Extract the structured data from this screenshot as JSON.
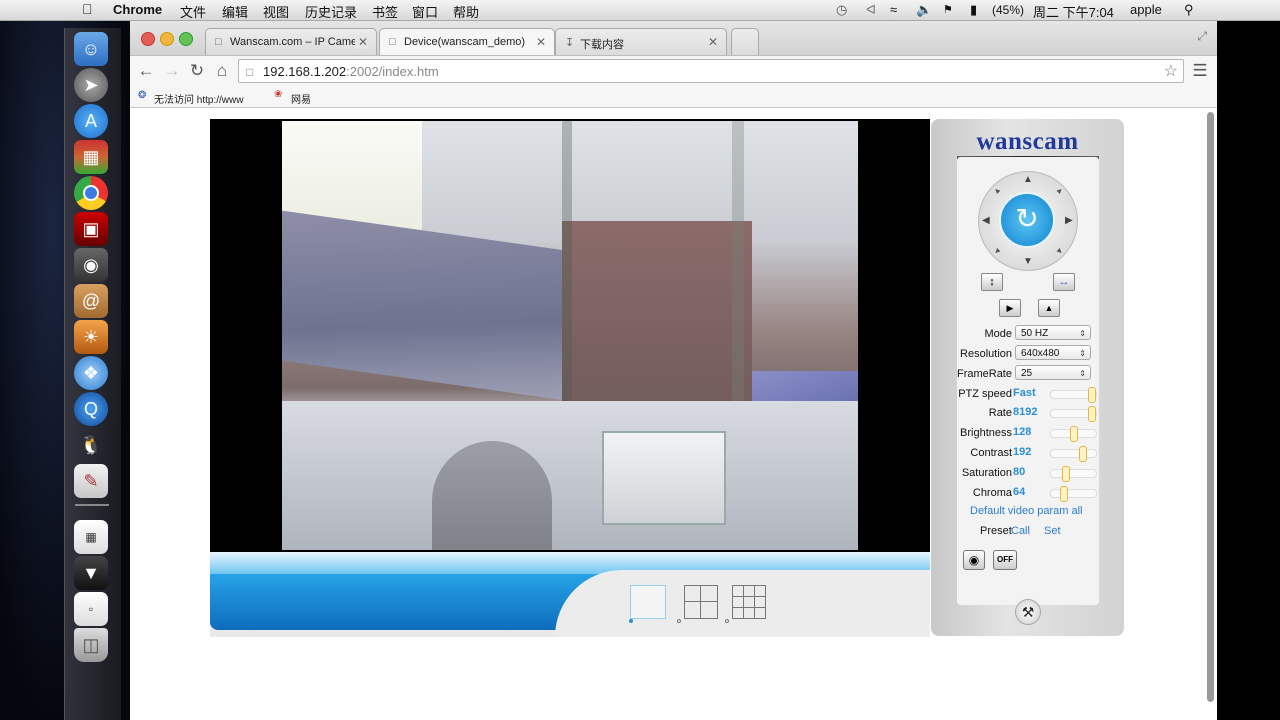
{
  "menubar": {
    "app": "Chrome",
    "menus": [
      "文件",
      "编辑",
      "视图",
      "历史记录",
      "书签",
      "窗口",
      "帮助"
    ],
    "battery": "(45%)",
    "clock": "周二 下午7:04",
    "user": "apple"
  },
  "tabs": [
    {
      "label": "Wanscam.com – IP Camera"
    },
    {
      "label": "Device(wanscam_demo)"
    },
    {
      "label": "下载内容"
    }
  ],
  "address": {
    "host": "192.168.1.202",
    "path": ":2002/index.htm"
  },
  "bookmarks": [
    {
      "label": "无法访问 http://www"
    },
    {
      "label": "网易"
    }
  ],
  "panel": {
    "logo": "wanscam",
    "rows": [
      {
        "label": "Mode",
        "value": "50 HZ"
      },
      {
        "label": "Resolution",
        "value": "640x480"
      },
      {
        "label": "FrameRate",
        "value": "25"
      }
    ],
    "sliders": [
      {
        "label": "PTZ speed",
        "value": "Fast",
        "level": 1.0
      },
      {
        "label": "Rate",
        "value": "8192",
        "level": 1.0
      },
      {
        "label": "Brightness",
        "value": "128",
        "level": 0.5
      },
      {
        "label": "Contrast",
        "value": "192",
        "level": 0.75
      },
      {
        "label": "Saturation",
        "value": "80",
        "level": 0.31
      },
      {
        "label": "Chroma",
        "value": "64",
        "level": 0.25
      }
    ],
    "default_link": "Default video param all",
    "preset_label": "Preset",
    "preset_call": "Call",
    "preset_set": "Set",
    "off_button": "OFF"
  },
  "colors": {
    "accent": "#2a8fd6",
    "blue_band": "#0f78c8"
  }
}
